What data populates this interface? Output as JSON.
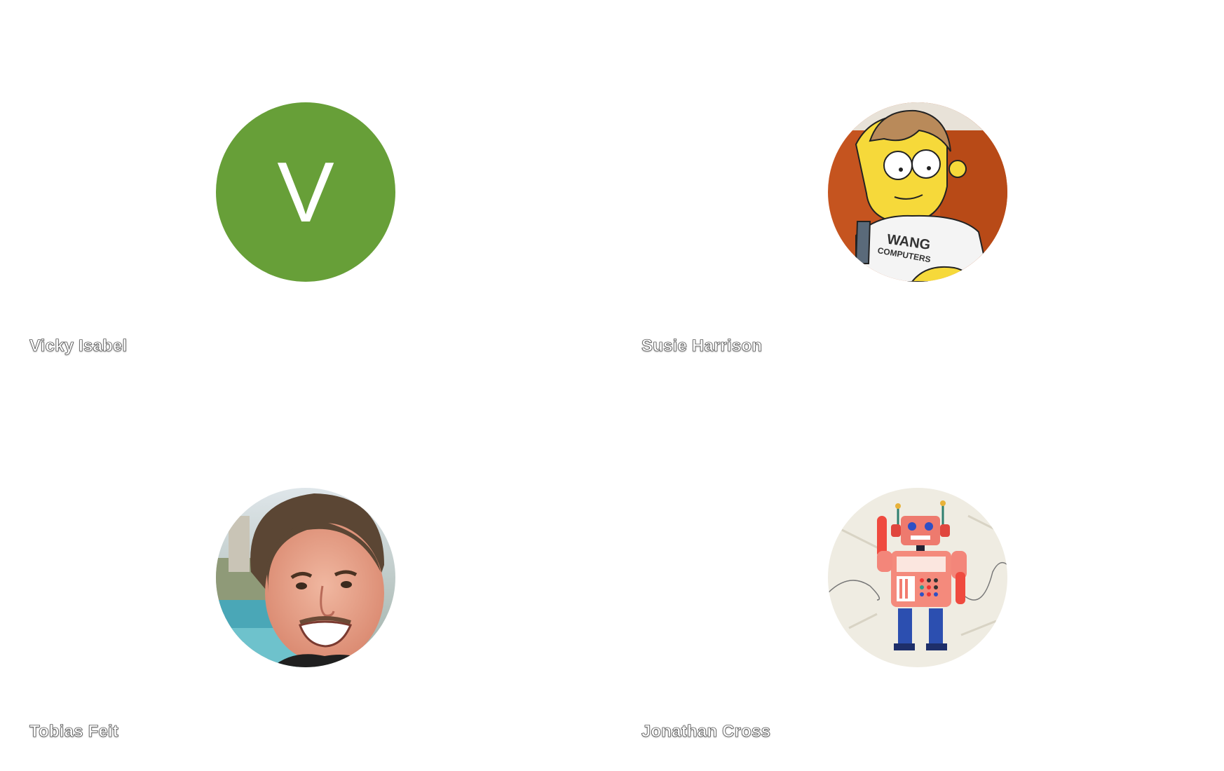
{
  "participants": [
    {
      "name": "Vicky Isabel",
      "avatar": {
        "kind": "initial",
        "letter": "V",
        "color": "#679f38"
      }
    },
    {
      "name": "Susie Harrison",
      "avatar": {
        "kind": "image",
        "subject": "cartoon-boy-wang-computers-shirt",
        "shirt_text_1": "WANG",
        "shirt_text_2": "COMPUTERS"
      }
    },
    {
      "name": "Tobias Feit",
      "avatar": {
        "kind": "image",
        "subject": "smiling-man-photo"
      }
    },
    {
      "name": "Jonathan Cross",
      "avatar": {
        "kind": "image",
        "subject": "toy-robot-illustration"
      }
    }
  ]
}
